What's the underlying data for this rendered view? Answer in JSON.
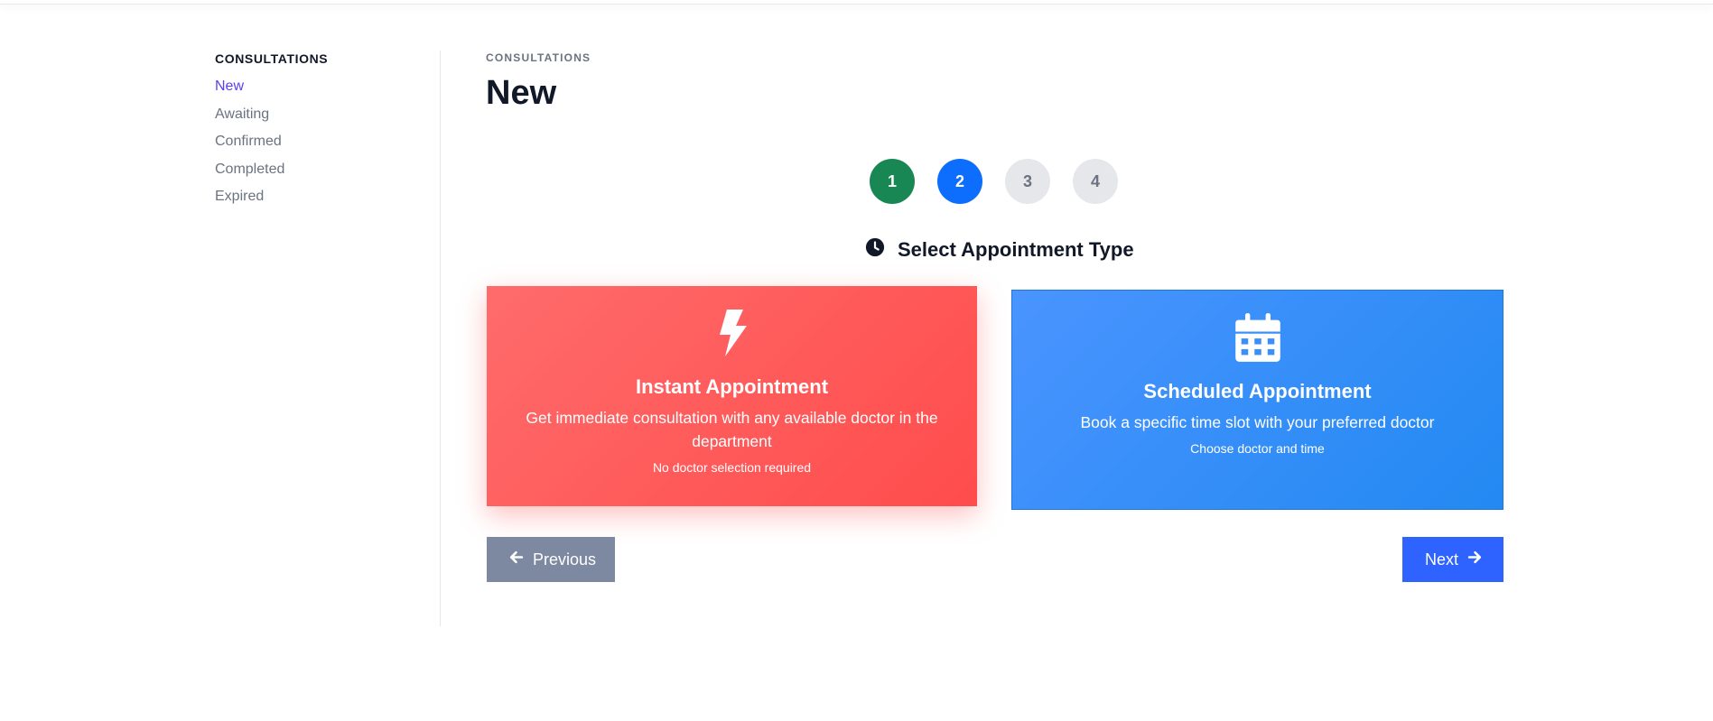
{
  "sidebar": {
    "heading": "CONSULTATIONS",
    "items": [
      {
        "label": "New",
        "active": true
      },
      {
        "label": "Awaiting"
      },
      {
        "label": "Confirmed"
      },
      {
        "label": "Completed"
      },
      {
        "label": "Expired"
      }
    ]
  },
  "header": {
    "breadcrumb": "CONSULTATIONS",
    "title": "New"
  },
  "steps": [
    {
      "label": "1",
      "state": "done"
    },
    {
      "label": "2",
      "state": "current"
    },
    {
      "label": "3",
      "state": "pending"
    },
    {
      "label": "4",
      "state": "pending"
    }
  ],
  "section": {
    "title": "Select Appointment Type",
    "icon": "clock-icon"
  },
  "cards": {
    "instant": {
      "icon": "bolt-icon",
      "title": "Instant Appointment",
      "description": "Get immediate consultation with any available doctor in the department",
      "note": "No doctor selection required"
    },
    "scheduled": {
      "icon": "calendar-icon",
      "title": "Scheduled Appointment",
      "description": "Book a specific time slot with your preferred doctor",
      "note": "Choose doctor and time"
    }
  },
  "buttons": {
    "previous": "Previous",
    "next": "Next"
  },
  "colors": {
    "accent": "#5b3df5",
    "step_done": "#198754",
    "step_current": "#0d6efd",
    "instant_card": "#ff5a5a",
    "scheduled_card": "#3a90f8",
    "previous_button": "#7d89a1",
    "next_button": "#2f63ff"
  }
}
